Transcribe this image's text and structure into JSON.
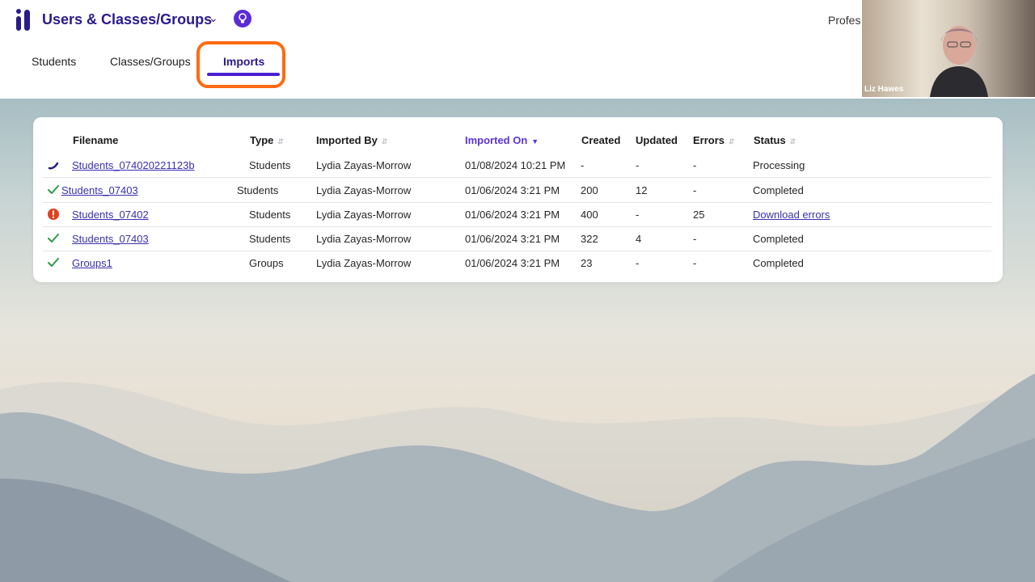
{
  "header": {
    "app_title": "Users & Classes/Groups",
    "profile_text": "Profes",
    "tabs": [
      {
        "label": "Students",
        "active": false
      },
      {
        "label": "Classes/Groups",
        "active": false
      },
      {
        "label": "Imports",
        "active": true
      }
    ],
    "accent_color": "#4a1fd0",
    "highlight_color": "#ff6a13"
  },
  "video": {
    "name": "Liz Hawes"
  },
  "table": {
    "columns": [
      {
        "label": "Filename",
        "sortable": false
      },
      {
        "label": "Type",
        "sortable": true
      },
      {
        "label": "Imported By",
        "sortable": true
      },
      {
        "label": "Imported On",
        "sortable": true,
        "active": true,
        "direction": "desc"
      },
      {
        "label": "Created",
        "sortable": false
      },
      {
        "label": "Updated",
        "sortable": false
      },
      {
        "label": "Errors",
        "sortable": true
      },
      {
        "label": "Status",
        "sortable": true
      }
    ],
    "rows": [
      {
        "icon": "processing-icon",
        "filename": "Students_074020221123b",
        "type": "Students",
        "imported_by": "Lydia Zayas-Morrow",
        "imported_on": "01/08/2024 10:21 PM",
        "created": "-",
        "updated": "-",
        "errors": "-",
        "status": "Processing",
        "status_link": false
      },
      {
        "icon": "check-icon",
        "filename": "Students_07403",
        "type": "Students",
        "imported_by": "Lydia Zayas-Morrow",
        "imported_on": "01/06/2024 3:21 PM",
        "created": "200",
        "updated": "12",
        "errors": "-",
        "status": "Completed",
        "status_link": false
      },
      {
        "icon": "error-icon",
        "filename": "Students_07402",
        "type": "Students",
        "imported_by": "Lydia Zayas-Morrow",
        "imported_on": "01/06/2024 3:21 PM",
        "created": "400",
        "updated": "-",
        "errors": "25",
        "status": "Download errors",
        "status_link": true
      },
      {
        "icon": "check-icon",
        "filename": "Students_07403",
        "type": "Students",
        "imported_by": "Lydia Zayas-Morrow",
        "imported_on": "01/06/2024 3:21 PM",
        "created": "322",
        "updated": "4",
        "errors": "-",
        "status": "Completed",
        "status_link": false
      },
      {
        "icon": "check-icon",
        "filename": "Groups1",
        "type": "Groups",
        "imported_by": "Lydia Zayas-Morrow",
        "imported_on": "01/06/2024 3:21 PM",
        "created": "23",
        "updated": "-",
        "errors": "-",
        "status": "Completed",
        "status_link": false
      }
    ]
  }
}
